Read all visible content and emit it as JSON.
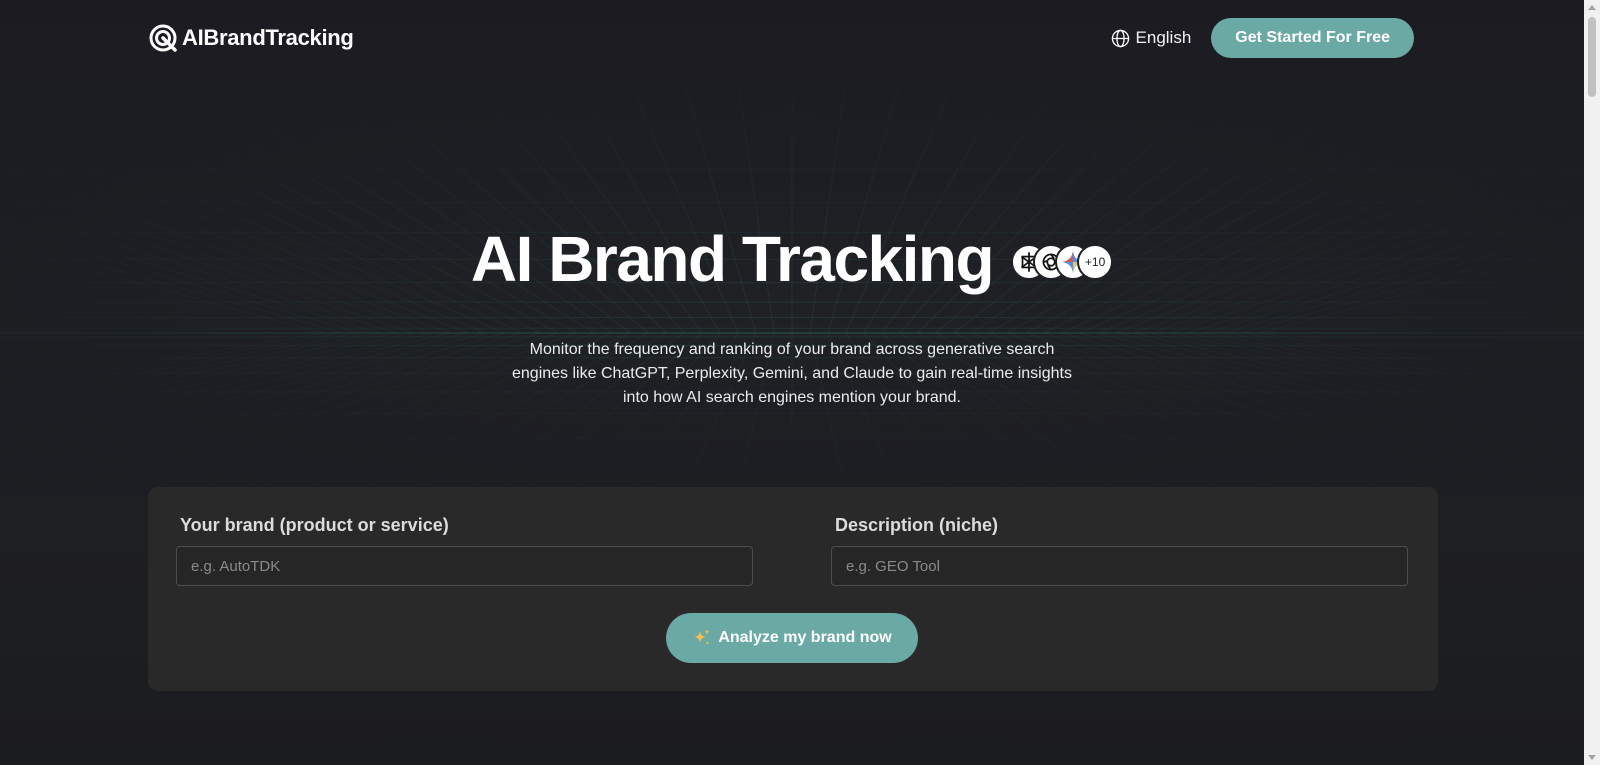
{
  "header": {
    "logo_text": "AIBrandTracking",
    "language_label": "English",
    "cta_label": "Get Started For Free"
  },
  "hero": {
    "title": "AI Brand Tracking",
    "engine_icons": [
      "perplexity-icon",
      "chatgpt-icon",
      "gemini-icon"
    ],
    "engines_more": "+10",
    "subtitle_lines": [
      "Monitor the frequency and ranking of your brand across generative search",
      "engines like ChatGPT, Perplexity, Gemini, and Claude to gain real-time insights",
      "into how AI search engines mention your brand."
    ]
  },
  "form": {
    "brand_label": "Your brand (product or service)",
    "brand_placeholder": "e.g. AutoTDK",
    "description_label": "Description (niche)",
    "description_placeholder": "e.g. GEO Tool",
    "analyze_label": "Analyze my brand now"
  },
  "colors": {
    "accent": "#6aa9a4",
    "background": "#1c1d22",
    "card": "#292929",
    "grid_line": "#2fa37f"
  }
}
